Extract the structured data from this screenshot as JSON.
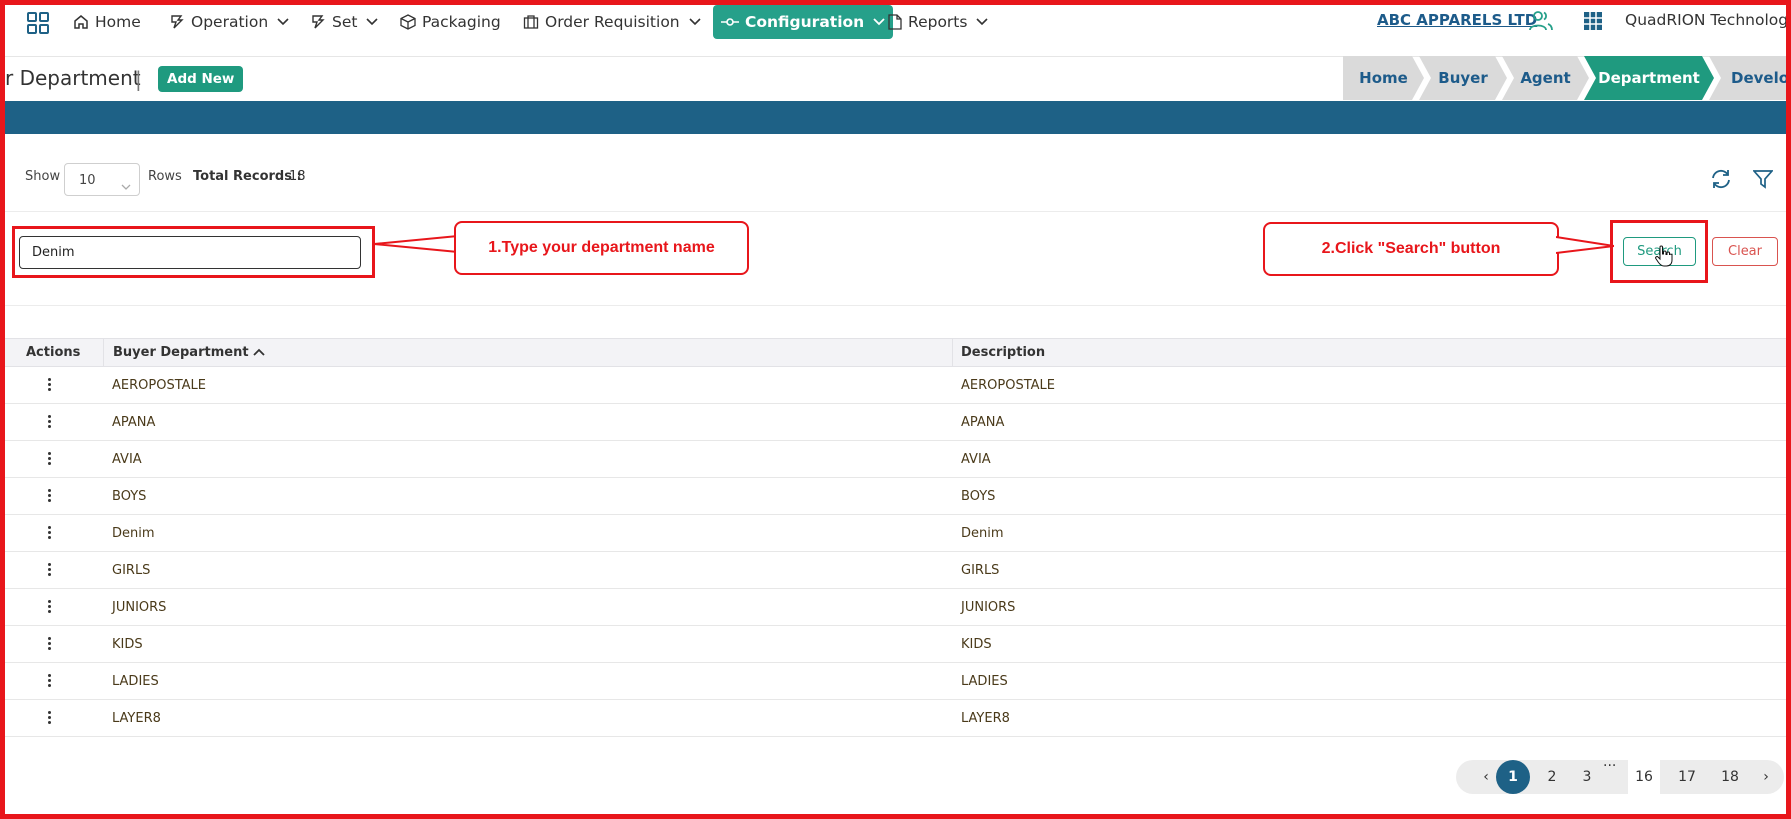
{
  "nav": {
    "items": [
      {
        "label": "Home",
        "icon": "home-icon"
      },
      {
        "label": "Operation",
        "icon": "operation-icon"
      },
      {
        "label": "Set",
        "icon": "set-icon"
      },
      {
        "label": "Packaging",
        "icon": "package-icon"
      },
      {
        "label": "Order Requisition",
        "icon": "requisition-icon"
      },
      {
        "label": "Configuration",
        "icon": "configuration-icon"
      },
      {
        "label": "Reports",
        "icon": "report-icon"
      }
    ],
    "company": "ABC APPARELS LTD",
    "brand": "QuadRION Technologies"
  },
  "page": {
    "title": "r Department",
    "title_separator": "|",
    "add_new_label": "Add New"
  },
  "breadcrumb": [
    "Home",
    "Buyer",
    "Agent",
    "Department",
    "Develo"
  ],
  "toolbar": {
    "show_label": "Show",
    "rows_value": "10",
    "rows_label": "Rows",
    "total_label": "Total Records :",
    "total_value": "18"
  },
  "search": {
    "value": "Denim",
    "search_label": "Search",
    "clear_label": "Clear"
  },
  "annotations": {
    "step1": "1.Type your department name",
    "step2": "2.Click \"Search\" button"
  },
  "table": {
    "headers": {
      "actions": "Actions",
      "department": "Buyer Department",
      "description": "Description"
    },
    "rows": [
      {
        "department": "AEROPOSTALE",
        "description": "AEROPOSTALE"
      },
      {
        "department": "APANA",
        "description": "APANA"
      },
      {
        "department": "AVIA",
        "description": "AVIA"
      },
      {
        "department": "BOYS",
        "description": "BOYS"
      },
      {
        "department": "Denim",
        "description": "Denim"
      },
      {
        "department": "GIRLS",
        "description": "GIRLS"
      },
      {
        "department": "JUNIORS",
        "description": "JUNIORS"
      },
      {
        "department": "KIDS",
        "description": "KIDS"
      },
      {
        "department": "LADIES",
        "description": "LADIES"
      },
      {
        "department": "LAYER8",
        "description": "LAYER8"
      }
    ]
  },
  "pagination": {
    "pages": [
      "1",
      "2",
      "3",
      "16",
      "17",
      "18"
    ],
    "current": "1",
    "ellipsis": "...",
    "prev": "‹",
    "next": "›"
  },
  "colors": {
    "accent": "#1f9a7f",
    "band": "#1e6186",
    "annotation": "#e8161b",
    "link": "#1d5b8a"
  }
}
